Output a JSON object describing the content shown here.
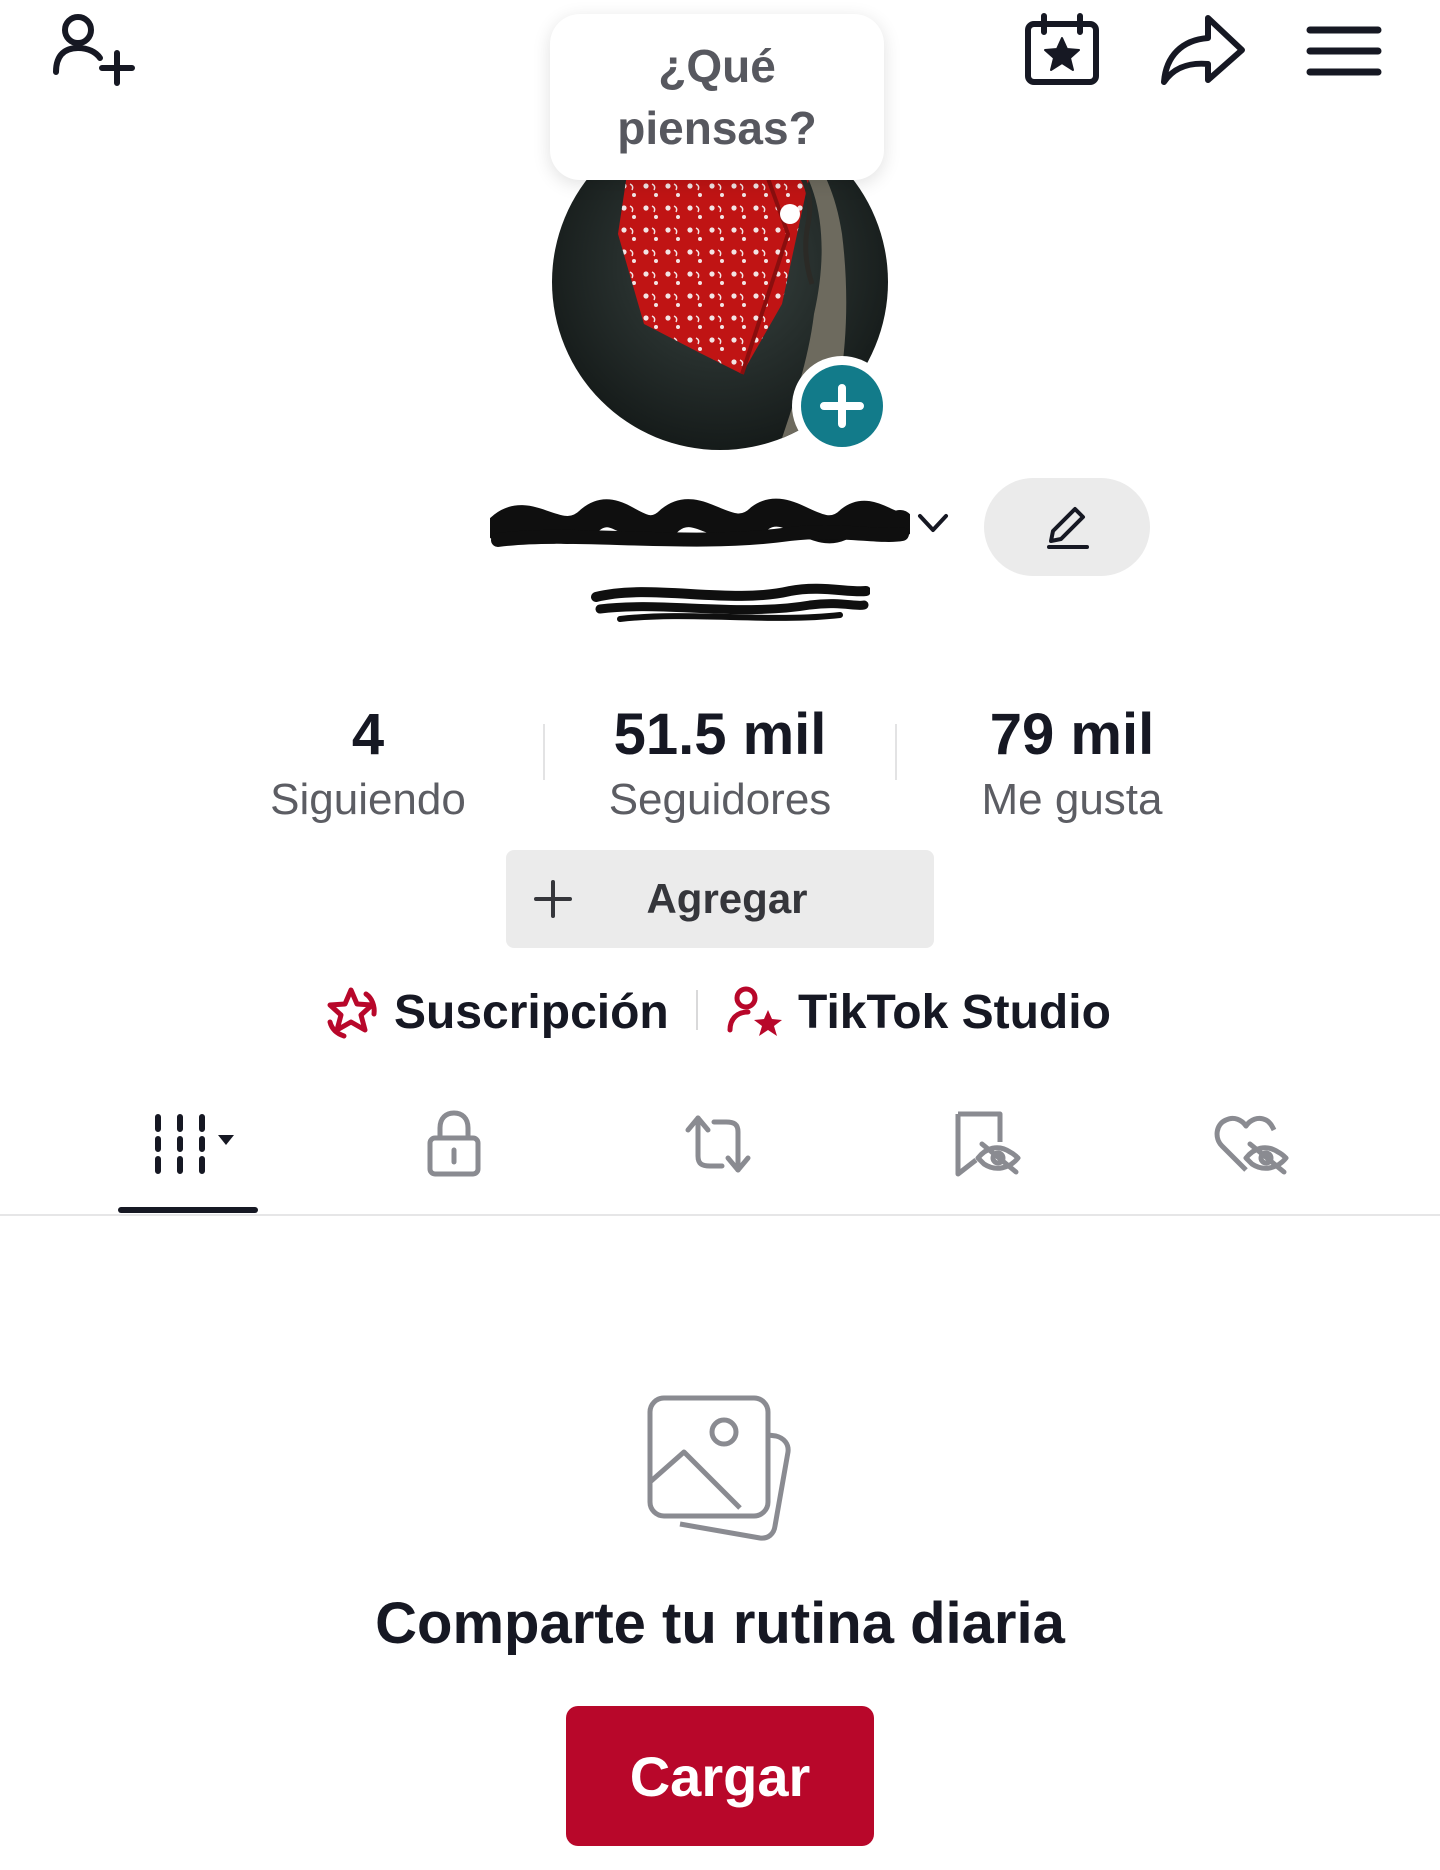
{
  "header": {
    "add_friend_icon": "person-plus-icon",
    "events_icon": "calendar-star-icon",
    "share_icon": "share-arrow-icon",
    "menu_icon": "hamburger-menu-icon"
  },
  "status_bubble": {
    "text": "¿Qué piensas?"
  },
  "profile": {
    "display_name": "",
    "username": "",
    "avatar_add_icon": "plus-icon",
    "edit_icon": "pencil-icon"
  },
  "stats": [
    {
      "value": "4",
      "label": "Siguiendo"
    },
    {
      "value": "51.5 mil",
      "label": "Seguidores"
    },
    {
      "value": "79 mil",
      "label": "Me gusta"
    }
  ],
  "add_button": {
    "label": "Agregar"
  },
  "links": {
    "subscription": "Suscripción",
    "studio": "TikTok Studio"
  },
  "tabs": [
    {
      "icon": "videos-grid-icon",
      "active": true
    },
    {
      "icon": "lock-icon",
      "active": false
    },
    {
      "icon": "repost-icon",
      "active": false
    },
    {
      "icon": "bookmark-hidden-icon",
      "active": false
    },
    {
      "icon": "heart-hidden-icon",
      "active": false
    }
  ],
  "empty_state": {
    "icon": "photos-icon",
    "title": "Comparte tu rutina diaria",
    "button": "Cargar"
  },
  "colors": {
    "accent": "#b8072a",
    "teal": "#127b8a",
    "text": "#161823",
    "muted": "#8a8b91"
  }
}
